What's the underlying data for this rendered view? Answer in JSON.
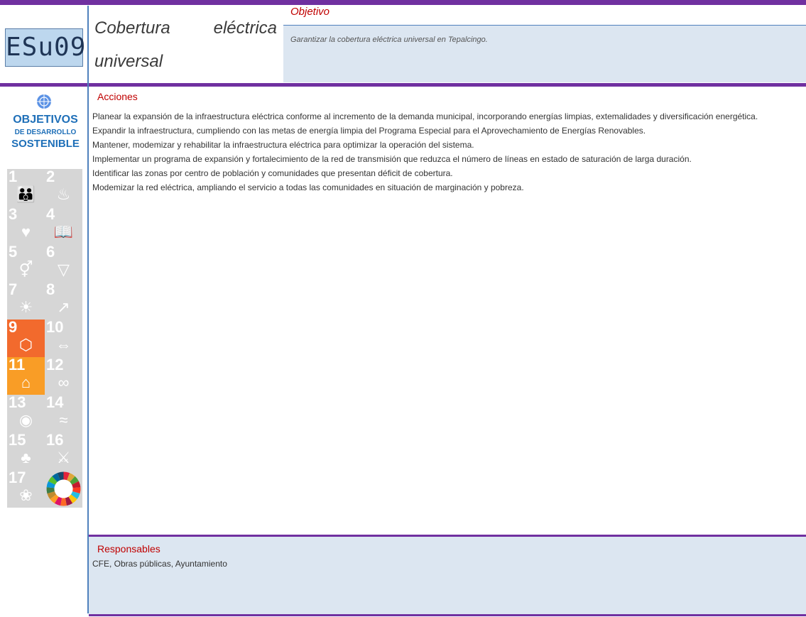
{
  "header": {
    "code": "ESu09",
    "title_line1_a": "Cobertura",
    "title_line1_b": "eléctrica",
    "title_line2": "universal",
    "objetivo_label": "Objetivo",
    "objetivo_text": "Garantizar la cobertura eléctrica universal en Tepalcingo."
  },
  "sidebar": {
    "logo_line1": "OBJETIVOS",
    "logo_line2": "DE DESARROLLO",
    "logo_line3": "SOSTENIBLE",
    "tiles": [
      {
        "num": "1",
        "icon": "people-icon",
        "active": false
      },
      {
        "num": "2",
        "icon": "bowl-icon",
        "active": false
      },
      {
        "num": "3",
        "icon": "heartbeat-icon",
        "active": false
      },
      {
        "num": "4",
        "icon": "book-icon",
        "active": false
      },
      {
        "num": "5",
        "icon": "gender-icon",
        "active": false
      },
      {
        "num": "6",
        "icon": "water-icon",
        "active": false
      },
      {
        "num": "7",
        "icon": "sun-icon",
        "active": false
      },
      {
        "num": "8",
        "icon": "growth-icon",
        "active": false
      },
      {
        "num": "9",
        "icon": "cubes-icon",
        "active": true,
        "color": "#f26a2d"
      },
      {
        "num": "10",
        "icon": "equality-icon",
        "active": false
      },
      {
        "num": "11",
        "icon": "city-icon",
        "active": true,
        "color": "#f99d26"
      },
      {
        "num": "12",
        "icon": "infinity-icon",
        "active": false
      },
      {
        "num": "13",
        "icon": "eye-icon",
        "active": false
      },
      {
        "num": "14",
        "icon": "fish-icon",
        "active": false
      },
      {
        "num": "15",
        "icon": "tree-icon",
        "active": false
      },
      {
        "num": "16",
        "icon": "dove-icon",
        "active": false
      },
      {
        "num": "17",
        "icon": "flower-icon",
        "active": false
      },
      {
        "num": "",
        "icon": "sdg-wheel-icon",
        "active": false
      }
    ]
  },
  "acciones": {
    "label": "Acciones",
    "items": [
      "Planear la expansión de la infraestructura eléctrica conforme al incremento de la demanda municipal, incorporando energías limpias, extemalidades y diversificación energética.",
      "Expandir la infraestructura, cumpliendo con las metas de energía limpia del Programa Especial para el Aprovechamiento de Energías Renovables.",
      "Mantener, modemizar y rehabilitar la infraestructura eléctrica para optimizar la operación del sistema.",
      "Implementar un programa de expansión y fortalecimiento de la red de transmisión que reduzca el número de líneas en estado de saturación de larga duración.",
      "Identificar las zonas por centro de población y comunidades que presentan déficit de cobertura.",
      "Modemizar la red eléctrica, ampliando el servicio a todas las comunidades en situación de marginación y pobreza."
    ]
  },
  "responsables": {
    "label": "Responsables",
    "text": "CFE, Obras públicas, Ayuntamiento"
  },
  "colors": {
    "purple_rule": "#7030a0",
    "accent_red": "#c00000",
    "light_blue": "#dce6f1",
    "sdg9": "#f26a2d",
    "sdg11": "#f99d26"
  }
}
